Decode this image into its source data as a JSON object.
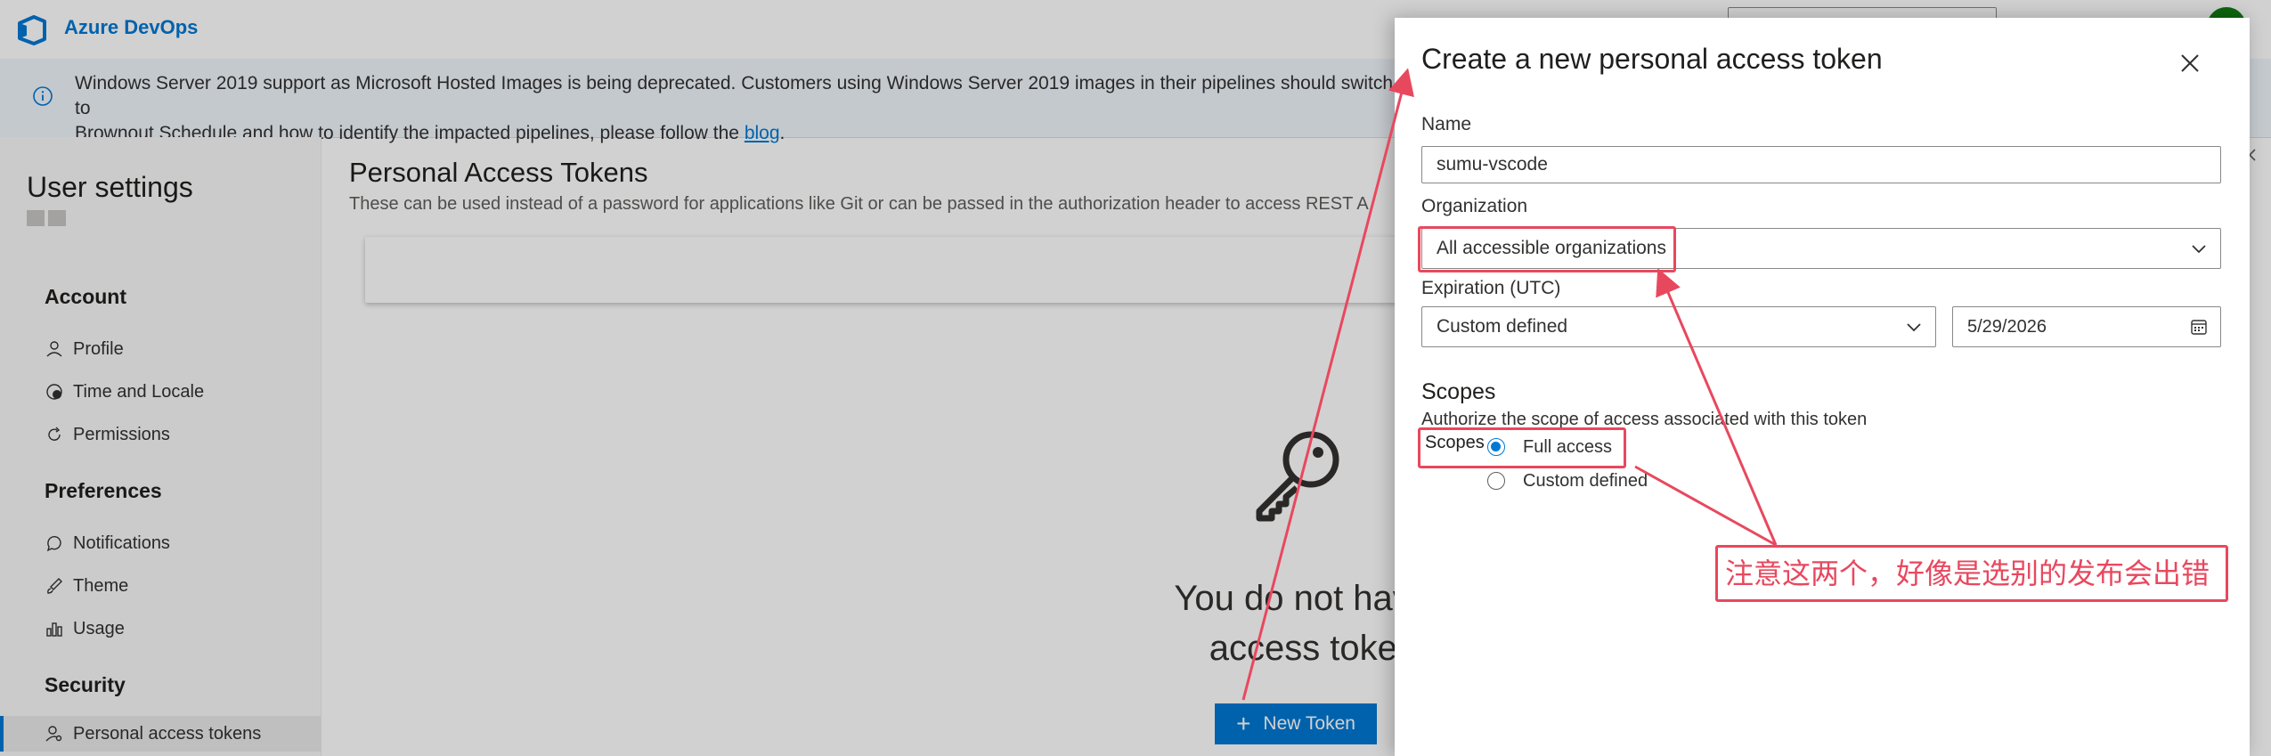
{
  "topbar": {
    "brand": "Azure DevOps"
  },
  "banner": {
    "line1": "Windows Server 2019 support as Microsoft Hosted Images is being deprecated. Customers using Windows Server 2019 images in their pipelines should switch to",
    "line2_prefix": "Brownout Schedule and how to identify the impacted pipelines, please follow the ",
    "link": "blog",
    "line2_suffix": "."
  },
  "sidebar": {
    "title": "User settings",
    "groups": [
      {
        "label": "Account",
        "items": [
          "Profile",
          "Time and Locale",
          "Permissions"
        ]
      },
      {
        "label": "Preferences",
        "items": [
          "Notifications",
          "Theme",
          "Usage"
        ]
      },
      {
        "label": "Security",
        "items": [
          "Personal access tokens"
        ]
      }
    ],
    "active_item": "Personal access tokens"
  },
  "main": {
    "title": "Personal Access Tokens",
    "description": "These can be used instead of a password for applications like Git or can be passed in the authorization header to access REST A",
    "empty_line1": "You do not have any",
    "empty_line2": "access tokens y",
    "new_token_label": "New Token"
  },
  "panel": {
    "title": "Create a new personal access token",
    "name_label": "Name",
    "name_value": "sumu-vscode",
    "org_label": "Organization",
    "org_value": "All accessible organizations",
    "expiration_label": "Expiration (UTC)",
    "expiration_value": "Custom defined",
    "date_value": "5/29/2026",
    "scopes_heading": "Scopes",
    "scopes_desc": "Authorize the scope of access associated with this token",
    "scopes_label": "Scopes",
    "scope_options": [
      "Full access",
      "Custom defined"
    ],
    "scope_selected": "Full access"
  },
  "annotation": {
    "note": "注意这两个，好像是选别的发布会出错",
    "color": "#e8485e"
  },
  "colors": {
    "accent": "#0078d4",
    "annotation": "#e8485e"
  }
}
